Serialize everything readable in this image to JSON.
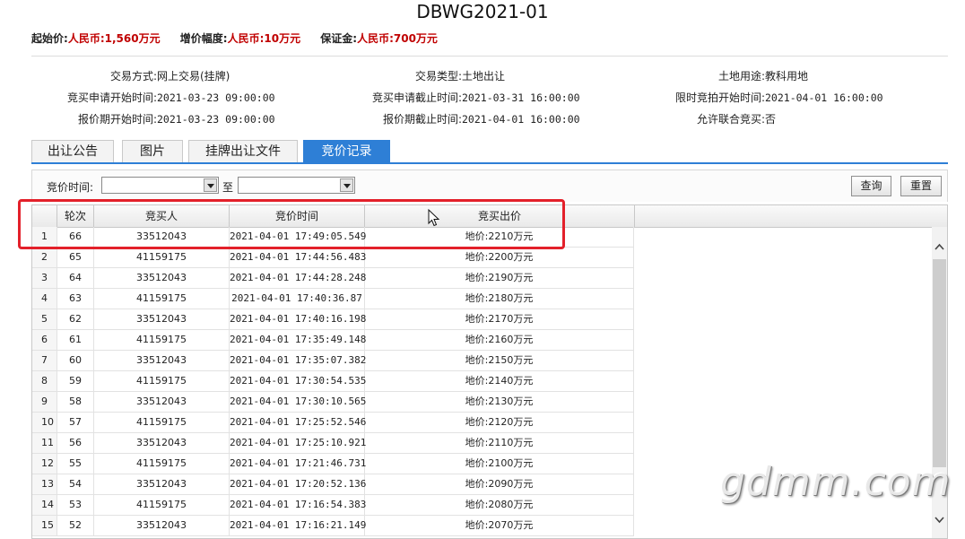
{
  "title": "DBWG2021-01",
  "pricing": {
    "start_label": "起始价:",
    "start_value": "人民币:1,560万元",
    "incr_label": "增价幅度:",
    "incr_value": "人民币:10万元",
    "deposit_label": "保证金:",
    "deposit_value": "人民币:700万元"
  },
  "info": {
    "trade_mode_label": "交易方式:",
    "trade_mode": "网上交易(挂牌)",
    "trade_type_label": "交易类型:",
    "trade_type": "土地出让",
    "land_use_label": "土地用途:",
    "land_use": "教科用地",
    "apply_start_label": "竞买申请开始时间:",
    "apply_start": "2021-03-23 09:00:00",
    "apply_end_label": "竞买申请截止时间:",
    "apply_end": "2021-03-31 16:00:00",
    "limit_start_label": "限时竞拍开始时间:",
    "limit_start": "2021-04-01 16:00:00",
    "quote_start_label": "报价期开始时间:",
    "quote_start": "2021-03-23 09:00:00",
    "quote_end_label": "报价期截止时间:",
    "quote_end": "2021-04-01 16:00:00",
    "joint_label": "允许联合竞买:",
    "joint": "否"
  },
  "tabs": [
    {
      "label": "出让公告"
    },
    {
      "label": "图片"
    },
    {
      "label": "挂牌出让文件"
    },
    {
      "label": "竞价记录"
    }
  ],
  "filter": {
    "label": "竞价时间:",
    "to": "至",
    "query_button": "查询",
    "reset_button": "重置"
  },
  "table": {
    "headers": [
      "轮次",
      "竞买人",
      "竞价时间",
      "竞买出价"
    ],
    "rows": [
      {
        "idx": "1",
        "round": "66",
        "bidder": "33512043",
        "time": "2021-04-01 17:49:05.549",
        "price": "地价:2210万元"
      },
      {
        "idx": "2",
        "round": "65",
        "bidder": "41159175",
        "time": "2021-04-01 17:44:56.483",
        "price": "地价:2200万元"
      },
      {
        "idx": "3",
        "round": "64",
        "bidder": "33512043",
        "time": "2021-04-01 17:44:28.248",
        "price": "地价:2190万元"
      },
      {
        "idx": "4",
        "round": "63",
        "bidder": "41159175",
        "time": "2021-04-01 17:40:36.87",
        "price": "地价:2180万元"
      },
      {
        "idx": "5",
        "round": "62",
        "bidder": "33512043",
        "time": "2021-04-01 17:40:16.198",
        "price": "地价:2170万元"
      },
      {
        "idx": "6",
        "round": "61",
        "bidder": "41159175",
        "time": "2021-04-01 17:35:49.148",
        "price": "地价:2160万元"
      },
      {
        "idx": "7",
        "round": "60",
        "bidder": "33512043",
        "time": "2021-04-01 17:35:07.382",
        "price": "地价:2150万元"
      },
      {
        "idx": "8",
        "round": "59",
        "bidder": "41159175",
        "time": "2021-04-01 17:30:54.535",
        "price": "地价:2140万元"
      },
      {
        "idx": "9",
        "round": "58",
        "bidder": "33512043",
        "time": "2021-04-01 17:30:10.565",
        "price": "地价:2130万元"
      },
      {
        "idx": "10",
        "round": "57",
        "bidder": "41159175",
        "time": "2021-04-01 17:25:52.546",
        "price": "地价:2120万元"
      },
      {
        "idx": "11",
        "round": "56",
        "bidder": "33512043",
        "time": "2021-04-01 17:25:10.921",
        "price": "地价:2110万元"
      },
      {
        "idx": "12",
        "round": "55",
        "bidder": "41159175",
        "time": "2021-04-01 17:21:46.731",
        "price": "地价:2100万元"
      },
      {
        "idx": "13",
        "round": "54",
        "bidder": "33512043",
        "time": "2021-04-01 17:20:52.136",
        "price": "地价:2090万元"
      },
      {
        "idx": "14",
        "round": "53",
        "bidder": "41159175",
        "time": "2021-04-01 17:16:54.383",
        "price": "地价:2080万元"
      },
      {
        "idx": "15",
        "round": "52",
        "bidder": "33512043",
        "time": "2021-04-01 17:16:21.149",
        "price": "地价:2070万元"
      }
    ]
  },
  "watermark": "gdmm.com"
}
